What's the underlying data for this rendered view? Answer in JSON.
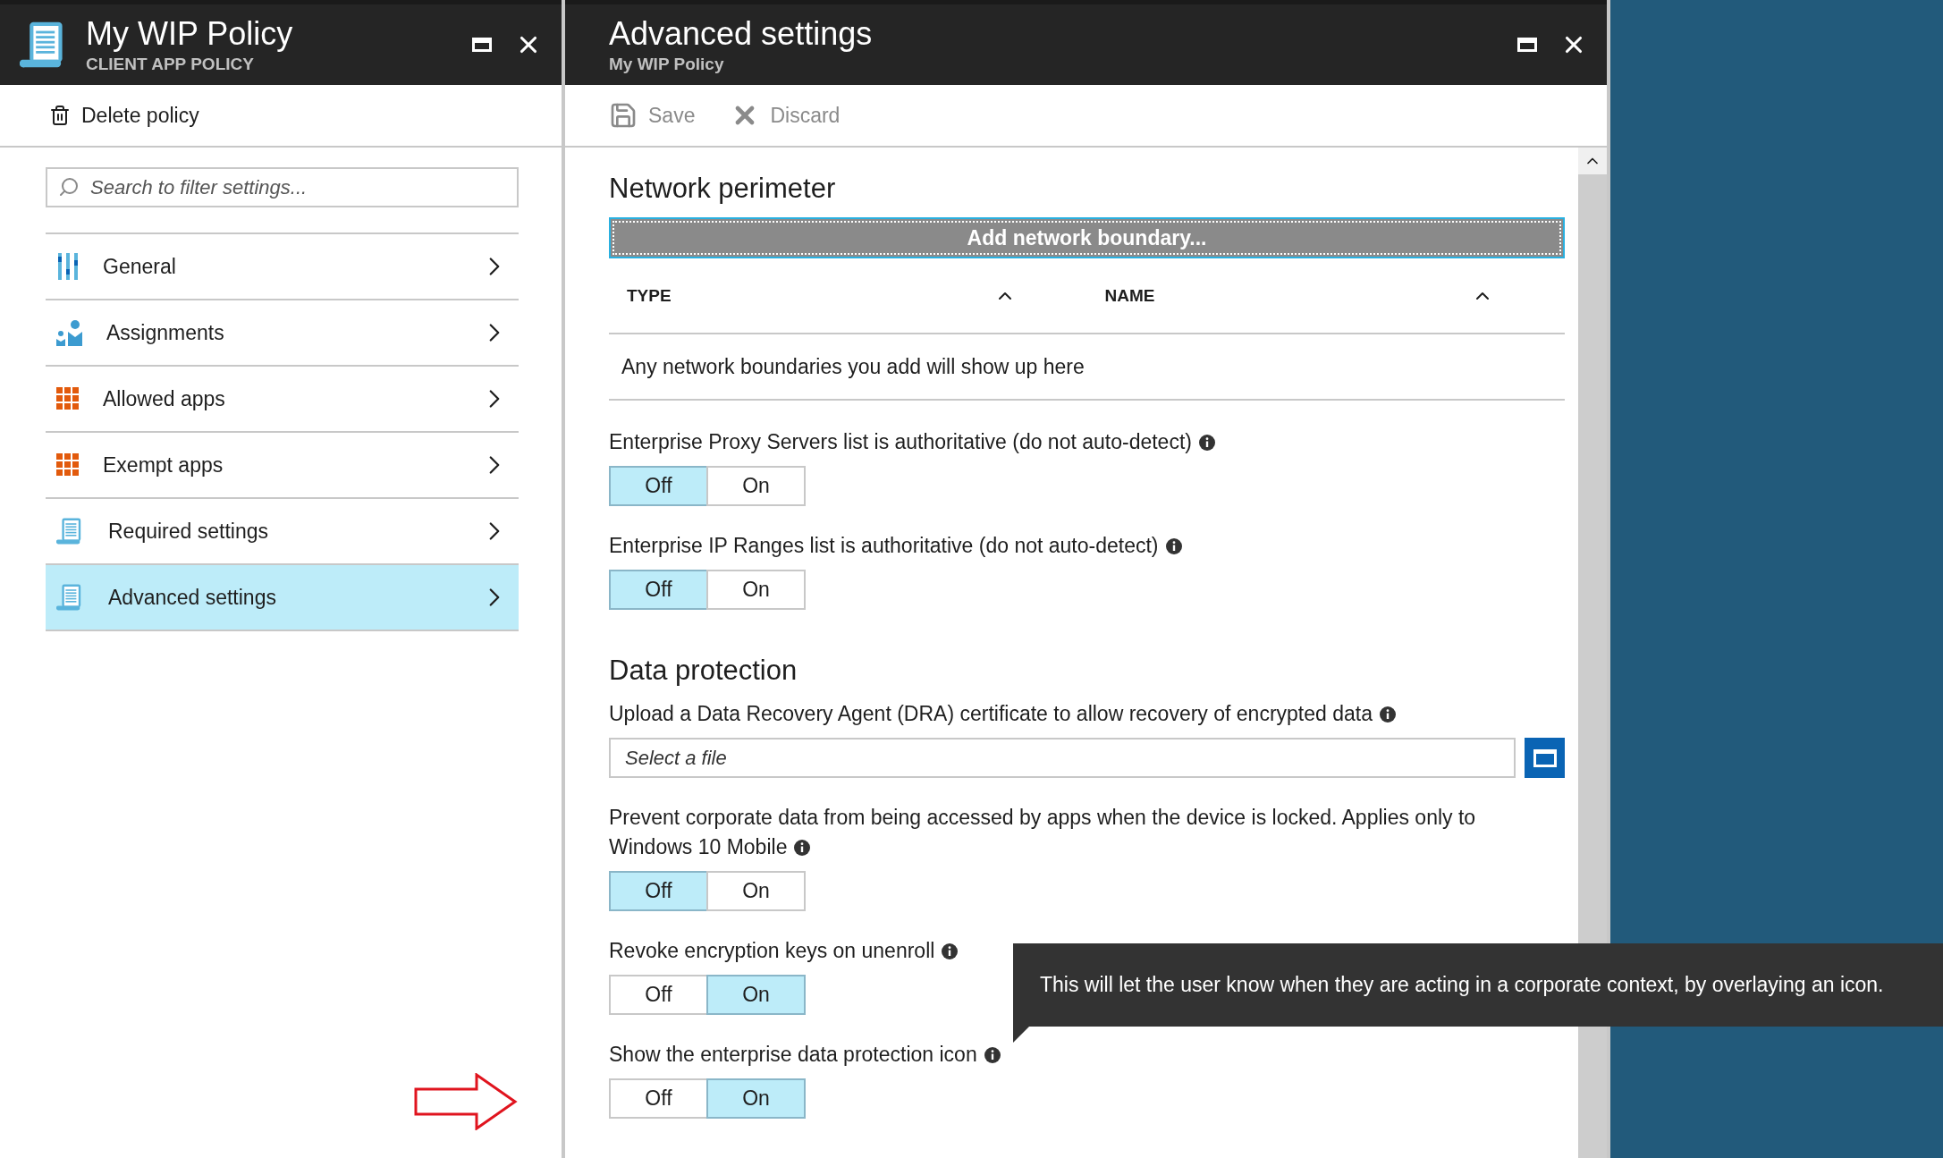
{
  "left_blade": {
    "title": "My WIP Policy",
    "subtitle": "CLIENT APP POLICY",
    "toolbar": [
      {
        "kind": "delete",
        "label": "Delete policy"
      }
    ],
    "search": {
      "placeholder": "Search to filter settings..."
    },
    "items": [
      {
        "kind": "sliders",
        "label": "General",
        "selected": false
      },
      {
        "kind": "people",
        "label": "Assignments",
        "selected": false
      },
      {
        "kind": "grid",
        "label": "Allowed apps",
        "selected": false
      },
      {
        "kind": "grid",
        "label": "Exempt apps",
        "selected": false
      },
      {
        "kind": "scroll",
        "label": "Required settings",
        "selected": false
      },
      {
        "kind": "scroll",
        "label": "Advanced settings",
        "selected": true
      }
    ]
  },
  "right_blade": {
    "title": "Advanced settings",
    "subtitle": "My WIP Policy",
    "toolbar": [
      {
        "kind": "save",
        "label": "Save",
        "disabled": true
      },
      {
        "kind": "discard",
        "label": "Discard",
        "disabled": true
      }
    ],
    "blocks": [
      {
        "kind": "heading",
        "text": "Network perimeter"
      },
      {
        "kind": "button",
        "label": "Add network boundary..."
      },
      {
        "kind": "table",
        "columns": [
          "TYPE",
          "NAME"
        ],
        "empty_text": "Any network boundaries you add will show up here"
      },
      {
        "kind": "toggle",
        "label": "Enterprise Proxy Servers list is authoritative (do not auto-detect)",
        "options": [
          {
            "label": "Off",
            "selected": true
          },
          {
            "label": "On",
            "selected": false
          }
        ]
      },
      {
        "kind": "toggle",
        "label": "Enterprise IP Ranges list is authoritative (do not auto-detect)",
        "options": [
          {
            "label": "Off",
            "selected": true
          },
          {
            "label": "On",
            "selected": false
          }
        ]
      },
      {
        "kind": "heading",
        "text": "Data protection"
      },
      {
        "kind": "file",
        "label": "Upload a Data Recovery Agent (DRA) certificate to allow recovery of encrypted data",
        "placeholder": "Select a file"
      },
      {
        "kind": "toggle",
        "label": "Prevent corporate data from being accessed by apps when the device is locked. Applies only to Windows 10 Mobile",
        "options": [
          {
            "label": "Off",
            "selected": true
          },
          {
            "label": "On",
            "selected": false
          }
        ]
      },
      {
        "kind": "toggle",
        "label": "Revoke encryption keys on unenroll",
        "options": [
          {
            "label": "Off",
            "selected": false
          },
          {
            "label": "On",
            "selected": true
          }
        ]
      },
      {
        "kind": "toggle",
        "label": "Show the enterprise data protection icon",
        "tooltip": "This will let the user know when they are acting in a corporate context, by overlaying an icon.",
        "options": [
          {
            "label": "Off",
            "selected": false
          },
          {
            "label": "On",
            "selected": true
          }
        ]
      }
    ]
  }
}
